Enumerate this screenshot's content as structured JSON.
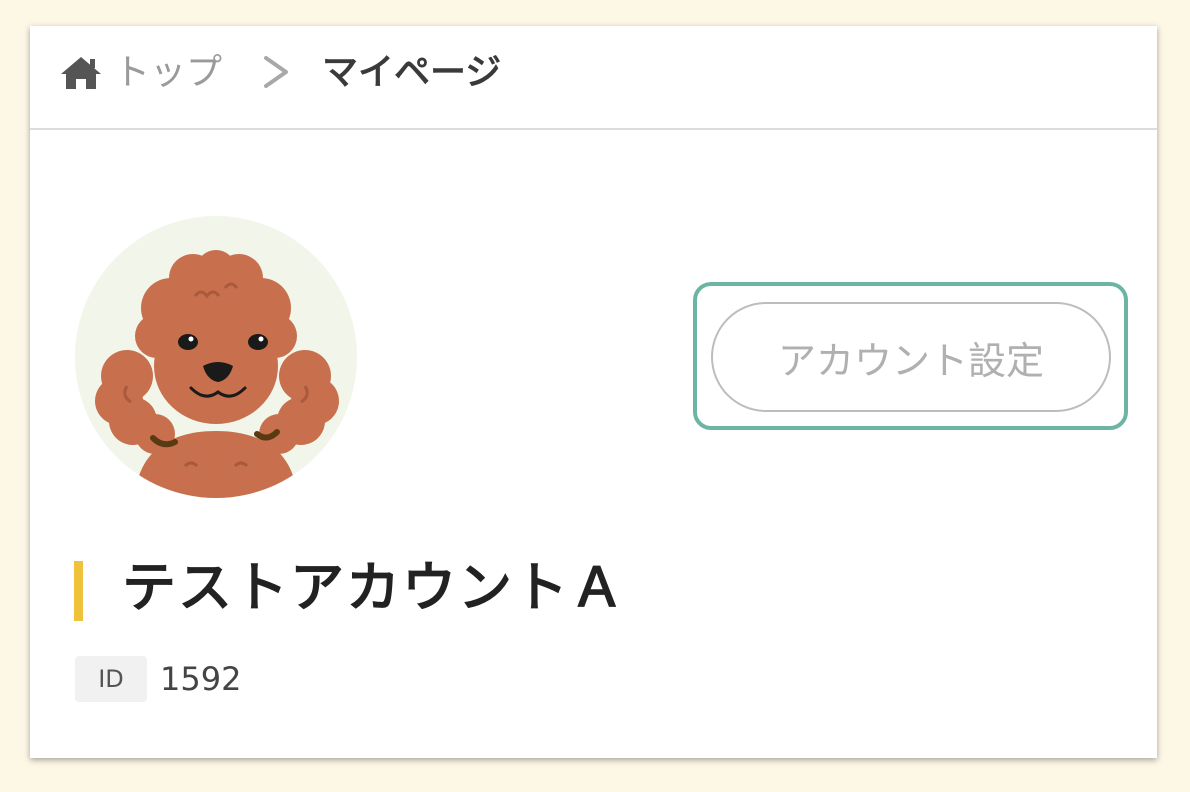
{
  "breadcrumb": {
    "home_icon": "home-icon",
    "top_label": "トップ",
    "separator_icon": "chevron-right-icon",
    "current_label": "マイページ"
  },
  "profile": {
    "avatar_icon": "poodle-dog-avatar",
    "account_name": "テストアカウントＡ",
    "id_label": "ID",
    "id_value": "1592",
    "settings_button_label": "アカウント設定"
  },
  "colors": {
    "page_background": "#fdf7e6",
    "highlight_frame": "#6db5a3",
    "name_accent_bar": "#f0c13a",
    "avatar_background": "#f2f6ea",
    "dog_fur": "#c86f4e"
  }
}
